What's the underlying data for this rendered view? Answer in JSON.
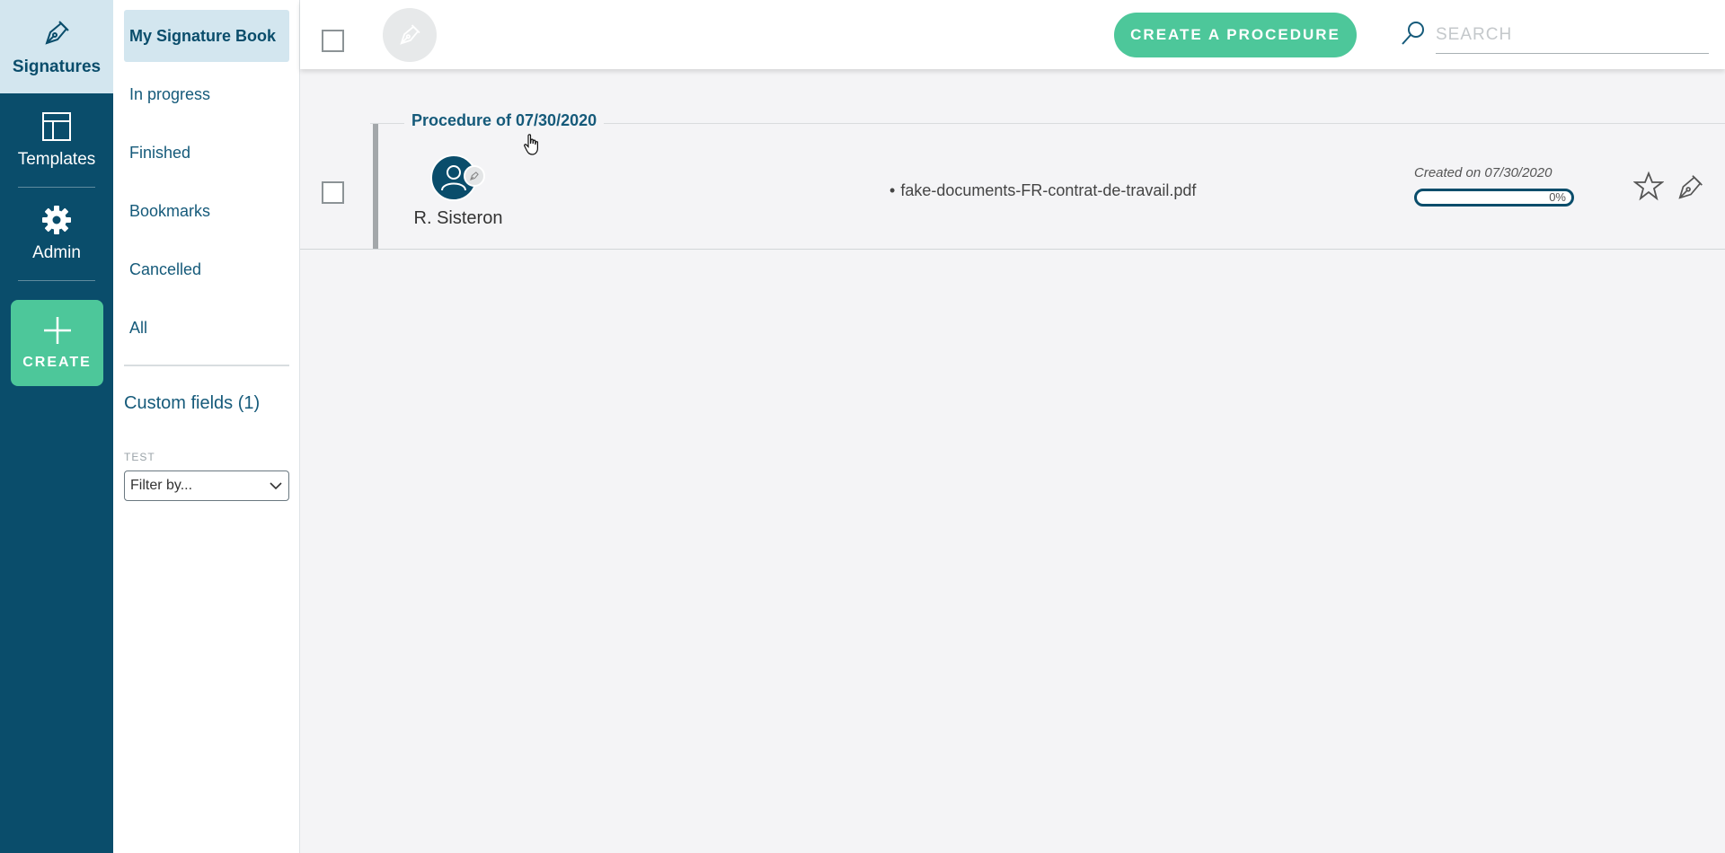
{
  "rail": {
    "items": [
      {
        "label": "Signatures",
        "icon": "pen-nib-icon",
        "active": true
      },
      {
        "label": "Templates",
        "icon": "layout-icon"
      },
      {
        "label": "Admin",
        "icon": "gear-icon"
      }
    ],
    "create_label": "CREATE"
  },
  "subnav": {
    "items": [
      {
        "label": "My Signature Book",
        "active": true
      },
      {
        "label": "In progress"
      },
      {
        "label": "Finished"
      },
      {
        "label": "Bookmarks"
      },
      {
        "label": "Cancelled"
      },
      {
        "label": "All"
      }
    ],
    "custom_fields_title": "Custom fields (1)",
    "filter_label": "TEST",
    "filter_value": "Filter by..."
  },
  "topbar": {
    "create_procedure_label": "CREATE A PROCEDURE",
    "search_placeholder": "SEARCH"
  },
  "procedures": [
    {
      "group_title": "Procedure of 07/30/2020",
      "signer": "R. Sisteron",
      "document": "fake-documents-FR-contrat-de-travail.pdf",
      "created": "Created on 07/30/2020",
      "progress": "0%",
      "progress_value": 0
    }
  ],
  "colors": {
    "primary": "#0a4d6b",
    "accent": "#4dc79a",
    "active_bg": "#d3e6ef"
  }
}
